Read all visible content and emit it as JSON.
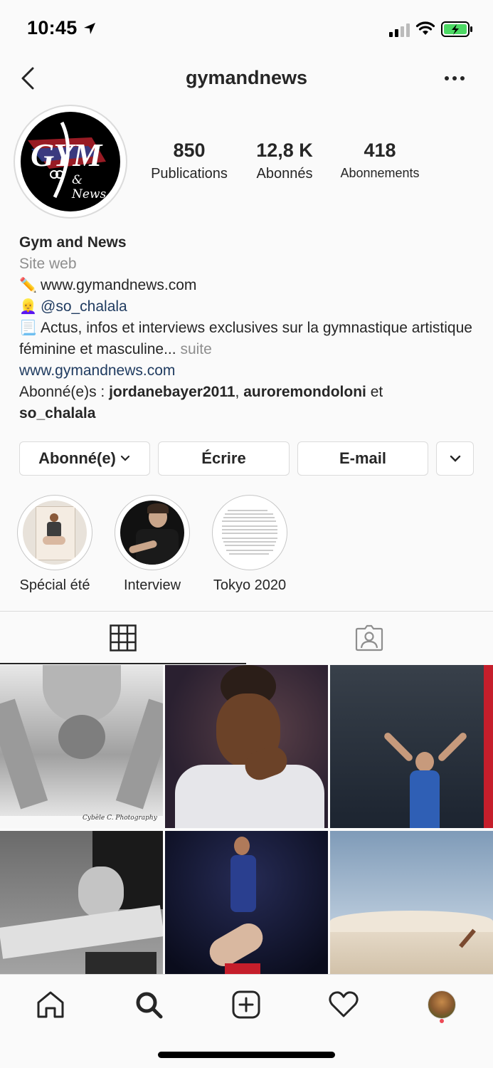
{
  "status_bar": {
    "time": "10:45"
  },
  "nav": {
    "username": "gymandnews",
    "back_icon": "chevron-left-icon",
    "more_icon": "ellipsis-icon"
  },
  "profile": {
    "avatar_text": "GYM",
    "avatar_subtext": "& News",
    "stats": [
      {
        "value": "850",
        "label": "Publications"
      },
      {
        "value": "12,8 K",
        "label": "Abonnés"
      },
      {
        "value": "418",
        "label": "Abonnements"
      }
    ],
    "name": "Gym and News",
    "category": "Site web",
    "bio_line1_emoji": "✏️",
    "bio_line1": "www.gymandnews.com",
    "bio_line2_emoji": "👱‍♀️",
    "bio_line2": "@so_chalala",
    "bio_line3_emoji": "📃",
    "bio_line3": "Actus, infos et interviews exclusives sur la gymnastique artistique féminine et masculine...",
    "more_label": "suite",
    "website": "www.gymandnews.com",
    "followed_by_prefix": "Abonné(e)s : ",
    "followed_by_1": "jordanebayer2011",
    "followed_by_sep": ", ",
    "followed_by_2": "auroremondoloni",
    "followed_by_and": " et",
    "followed_by_3": "so_chalala"
  },
  "buttons": {
    "following": "Abonné(e)",
    "message": "Écrire",
    "email": "E-mail"
  },
  "highlights": [
    {
      "label": "Spécial été"
    },
    {
      "label": "Interview"
    },
    {
      "label": "Tokyo 2020"
    }
  ],
  "tabs": {
    "grid_icon": "grid-icon",
    "tagged_icon": "tagged-person-icon",
    "active": "grid"
  },
  "grid_posts": [
    {
      "caption": "Cybèle C. Photography"
    }
  ],
  "tabbar": {
    "items": [
      "home-icon",
      "search-icon",
      "add-post-icon",
      "heart-icon",
      "profile-avatar"
    ],
    "active": "search-icon"
  },
  "colors": {
    "link": "#1e3a5f",
    "secondary": "#8e8e8e",
    "border": "#dbdbdb",
    "notification_dot": "#ed4956"
  }
}
